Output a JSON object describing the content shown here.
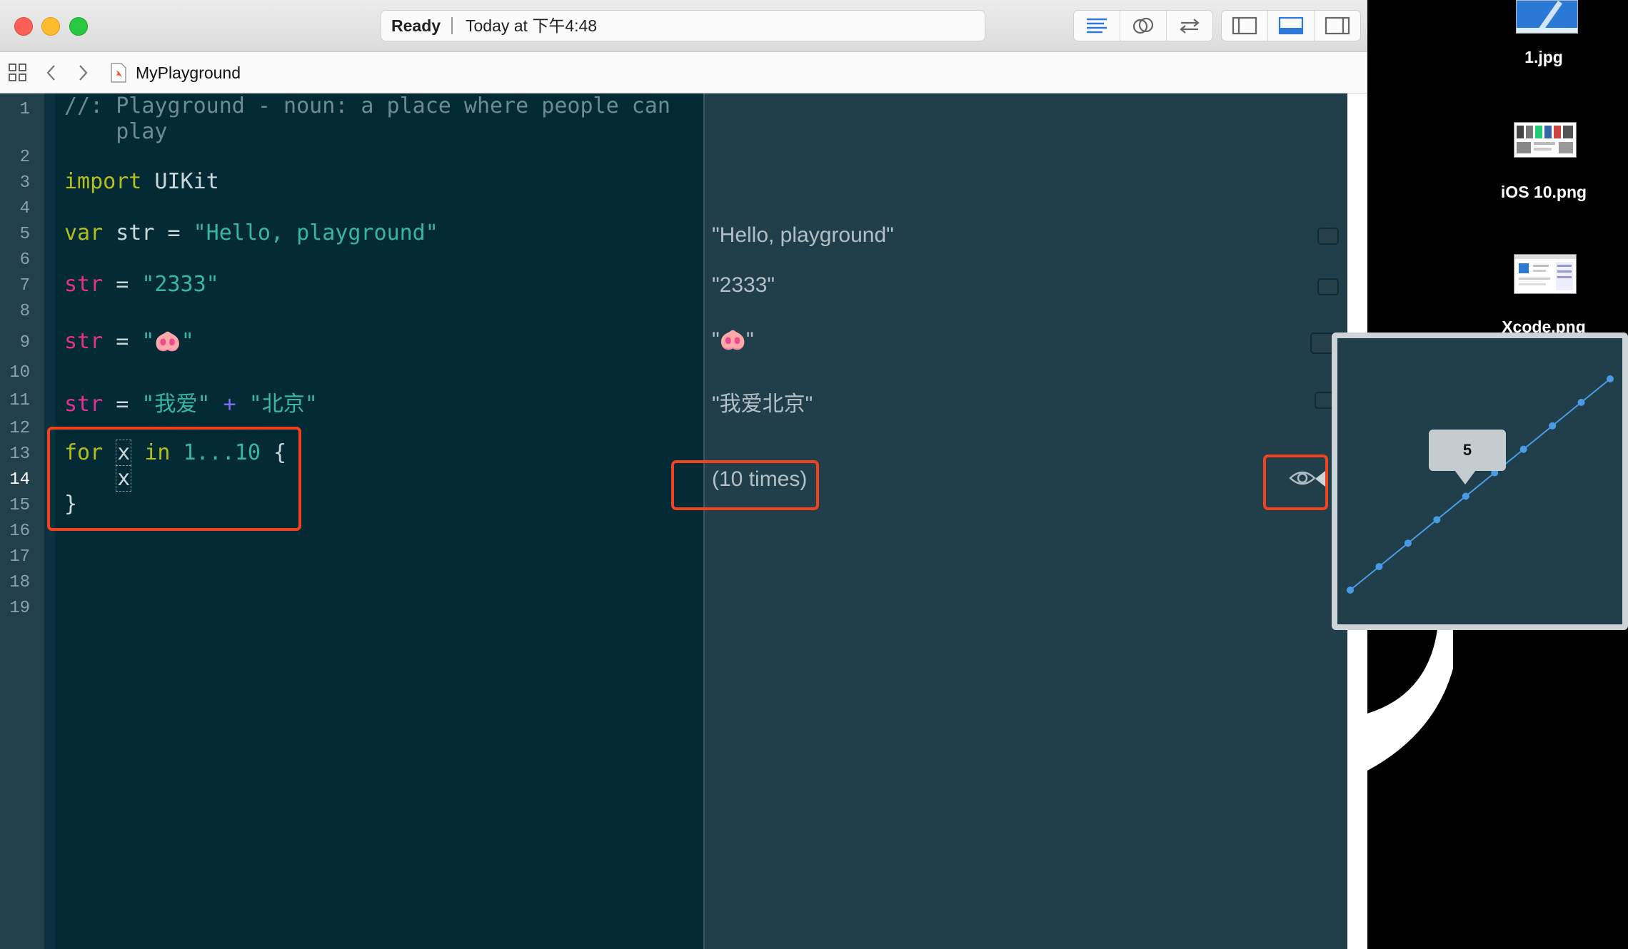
{
  "toolbar": {
    "status_label": "Ready",
    "time_label": "Today at 下午4:48"
  },
  "jumpbar": {
    "file_name": "MyPlayground"
  },
  "editor": {
    "line_numbers": [
      "1",
      "2",
      "3",
      "4",
      "5",
      "6",
      "7",
      "8",
      "9",
      "10",
      "11",
      "12",
      "13",
      "14",
      "15",
      "16",
      "17",
      "18",
      "19"
    ],
    "lines": {
      "l1a": "//: Playground - noun: a place where people can",
      "l1b": "    play",
      "import_kw": "import",
      "import_mod": " UIKit",
      "var_kw": "var",
      "str_name": " str = ",
      "hello_str": "\"Hello, playground\"",
      "str_var": "str",
      "eq": " = ",
      "s2333": "\"2333\"",
      "pig": "\"🐽\"",
      "wo_ai": "\"我爱\"",
      "plus": " + ",
      "beijing": "\"北京\"",
      "for_kw": "for",
      "x": "x",
      "in_kw": "in",
      "range": " 1...10 ",
      "brace_open": "{",
      "brace_close": "}"
    }
  },
  "results": {
    "r5": "\"Hello, playground\"",
    "r7": "\"2333\"",
    "r9": "\"🐽\"",
    "r11": "\"我爱北京\"",
    "r14": "(10 times)"
  },
  "desktop": {
    "icon1": "1.jpg",
    "icon2": "iOS 10.png",
    "icon3": "Xcode.png"
  },
  "graph": {
    "tooltip": "5"
  },
  "chart_data": {
    "type": "line",
    "x": [
      1,
      2,
      3,
      4,
      5,
      6,
      7,
      8,
      9,
      10
    ],
    "values": [
      1,
      2,
      3,
      4,
      5,
      6,
      7,
      8,
      9,
      10
    ],
    "highlighted_value": 5,
    "color": "#4a9be6"
  },
  "colors": {
    "highlight": "#f1431f",
    "editor_bg": "#042a36",
    "results_bg": "#213f4b",
    "keyword": "#b4bf1d",
    "string": "#37b6a4",
    "variable": "#e3338c"
  }
}
